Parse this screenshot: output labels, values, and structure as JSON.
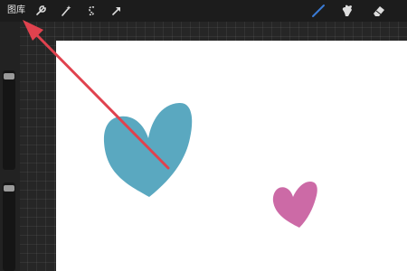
{
  "toolbar": {
    "gallery_label": "图库",
    "left_tools": [
      {
        "icon": "wrench-icon"
      },
      {
        "icon": "magic-wand-icon"
      },
      {
        "icon": "selection-s-icon"
      },
      {
        "icon": "transform-arrow-icon"
      }
    ],
    "right_tools": [
      {
        "icon": "brush-icon",
        "active": true
      },
      {
        "icon": "smudge-icon"
      },
      {
        "icon": "eraser-icon"
      }
    ],
    "accent_color": "#3a7bd5"
  },
  "canvas": {
    "background": "#ffffff",
    "shapes": [
      {
        "name": "heart",
        "color": "#5aa8c0"
      },
      {
        "name": "heart",
        "color": "#cc6aa6"
      }
    ]
  },
  "annotation": {
    "arrow_color": "#e0424e"
  },
  "sidebar": {
    "size_slider": {
      "value": 0.95
    },
    "opacity_slider": {
      "value": 0.95
    }
  }
}
